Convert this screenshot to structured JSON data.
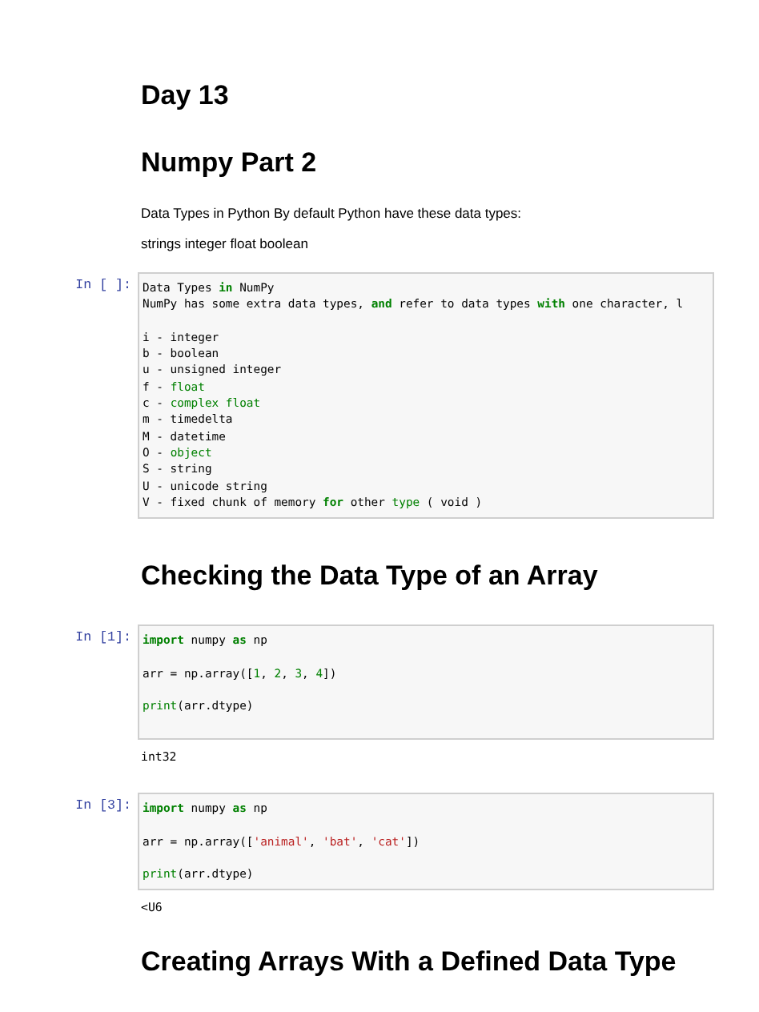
{
  "cells": [
    {
      "kind": "heading",
      "text": "Day 13"
    },
    {
      "kind": "heading",
      "text": "Numpy Part 2"
    },
    {
      "kind": "text",
      "text": "Data Types in Python By default Python have these data types:"
    },
    {
      "kind": "text",
      "text": "strings integer float boolean"
    },
    {
      "kind": "code",
      "prompt": "In [ ]:",
      "lines": [
        {
          "space_before": false,
          "space_after": false,
          "tokens": [
            {
              "text": "Data Types ",
              "kind": "plain"
            },
            {
              "text": "in",
              "kind": "kw"
            },
            {
              "text": " NumPy",
              "kind": "plain"
            }
          ]
        },
        {
          "space_before": false,
          "space_after": false,
          "tokens": [
            {
              "text": "NumPy has some extra data types, ",
              "kind": "plain"
            },
            {
              "text": "and",
              "kind": "kw"
            },
            {
              "text": " refer to data types ",
              "kind": "plain"
            },
            {
              "text": "with",
              "kind": "kw"
            },
            {
              "text": " one character, l",
              "kind": "plain"
            }
          ]
        },
        {
          "space_before": true,
          "space_after": false,
          "tokens": [
            {
              "text": "i - integer",
              "kind": "plain"
            }
          ]
        },
        {
          "space_before": false,
          "space_after": false,
          "tokens": [
            {
              "text": "b - boolean",
              "kind": "plain"
            }
          ]
        },
        {
          "space_before": false,
          "space_after": false,
          "tokens": [
            {
              "text": "u - unsigned integer",
              "kind": "plain"
            }
          ]
        },
        {
          "space_before": false,
          "space_after": false,
          "tokens": [
            {
              "text": "f - ",
              "kind": "plain"
            },
            {
              "text": "float",
              "kind": "builtin"
            }
          ]
        },
        {
          "space_before": false,
          "space_after": false,
          "tokens": [
            {
              "text": "c - ",
              "kind": "plain"
            },
            {
              "text": "complex float",
              "kind": "builtin"
            }
          ]
        },
        {
          "space_before": false,
          "space_after": false,
          "tokens": [
            {
              "text": "m - timedelta",
              "kind": "plain"
            }
          ]
        },
        {
          "space_before": false,
          "space_after": false,
          "tokens": [
            {
              "text": "M - datetime",
              "kind": "plain"
            }
          ]
        },
        {
          "space_before": false,
          "space_after": false,
          "tokens": [
            {
              "text": "O - ",
              "kind": "plain"
            },
            {
              "text": "object",
              "kind": "builtin"
            }
          ]
        },
        {
          "space_before": false,
          "space_after": false,
          "tokens": [
            {
              "text": "S - string",
              "kind": "plain"
            }
          ]
        },
        {
          "space_before": false,
          "space_after": false,
          "tokens": [
            {
              "text": "U - unicode string",
              "kind": "plain"
            }
          ]
        },
        {
          "space_before": false,
          "space_after": false,
          "tokens": [
            {
              "text": "V - fixed chunk of memory ",
              "kind": "plain"
            },
            {
              "text": "for",
              "kind": "kw"
            },
            {
              "text": " other ",
              "kind": "plain"
            },
            {
              "text": "type",
              "kind": "builtin"
            },
            {
              "text": " ( void )",
              "kind": "plain"
            }
          ]
        }
      ]
    },
    {
      "kind": "heading",
      "text": "Checking the Data Type of an Array"
    },
    {
      "kind": "code",
      "prompt": "In [1]:",
      "lines": [
        {
          "space_before": false,
          "space_after": false,
          "tokens": [
            {
              "text": "import",
              "kind": "kw"
            },
            {
              "text": " numpy ",
              "kind": "plain"
            },
            {
              "text": "as",
              "kind": "kw"
            },
            {
              "text": " np",
              "kind": "plain"
            }
          ]
        },
        {
          "space_before": true,
          "space_after": false,
          "tokens": [
            {
              "text": "arr = np.array([",
              "kind": "plain"
            },
            {
              "text": "1",
              "kind": "num"
            },
            {
              "text": ", ",
              "kind": "plain"
            },
            {
              "text": "2",
              "kind": "num"
            },
            {
              "text": ", ",
              "kind": "plain"
            },
            {
              "text": "3",
              "kind": "num"
            },
            {
              "text": ", ",
              "kind": "plain"
            },
            {
              "text": "4",
              "kind": "num"
            },
            {
              "text": "])",
              "kind": "plain"
            }
          ]
        },
        {
          "space_before": true,
          "space_after": true,
          "tokens": [
            {
              "text": "print",
              "kind": "builtin"
            },
            {
              "text": "(arr.dtype)",
              "kind": "plain"
            }
          ]
        }
      ],
      "output": "int32"
    },
    {
      "kind": "code",
      "prompt": "In [3]:",
      "lines": [
        {
          "space_before": false,
          "space_after": false,
          "tokens": [
            {
              "text": "import",
              "kind": "kw"
            },
            {
              "text": " numpy ",
              "kind": "plain"
            },
            {
              "text": "as",
              "kind": "kw"
            },
            {
              "text": " np",
              "kind": "plain"
            }
          ]
        },
        {
          "space_before": true,
          "space_after": false,
          "tokens": [
            {
              "text": "arr = np.array([",
              "kind": "plain"
            },
            {
              "text": "'animal'",
              "kind": "str"
            },
            {
              "text": ", ",
              "kind": "plain"
            },
            {
              "text": "'bat'",
              "kind": "str"
            },
            {
              "text": ", ",
              "kind": "plain"
            },
            {
              "text": "'cat'",
              "kind": "str"
            },
            {
              "text": "])",
              "kind": "plain"
            }
          ]
        },
        {
          "space_before": true,
          "space_after": false,
          "tokens": [
            {
              "text": "print",
              "kind": "builtin"
            },
            {
              "text": "(arr.dtype)",
              "kind": "plain"
            }
          ]
        }
      ],
      "output": "<U6"
    },
    {
      "kind": "heading",
      "text": "Creating Arrays With a Defined Data Type"
    }
  ]
}
